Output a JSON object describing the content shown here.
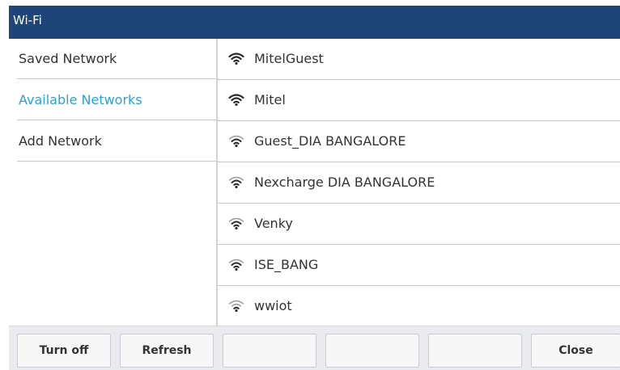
{
  "title": "Wi-Fi",
  "sidebar": {
    "items": [
      {
        "label": "Saved Network"
      },
      {
        "label": "Available Networks"
      },
      {
        "label": "Add Network"
      }
    ],
    "active_color": "#2aa0d8"
  },
  "networks": [
    {
      "ssid": "MitelGuest",
      "signal": "strong"
    },
    {
      "ssid": "Mitel",
      "signal": "strong"
    },
    {
      "ssid": "Guest_DIA BANGALORE",
      "signal": "good"
    },
    {
      "ssid": "Nexcharge DIA BANGALORE",
      "signal": "good"
    },
    {
      "ssid": "Venky",
      "signal": "good"
    },
    {
      "ssid": "ISE_BANG",
      "signal": "good"
    },
    {
      "ssid": "wwiot",
      "signal": "weak"
    }
  ],
  "softkeys": [
    {
      "label": "Turn off"
    },
    {
      "label": "Refresh"
    },
    {
      "label": ""
    },
    {
      "label": ""
    },
    {
      "label": ""
    },
    {
      "label": "Close"
    }
  ],
  "colors": {
    "title_bar": "#1f4477",
    "toolbar": "#e9ebef"
  }
}
